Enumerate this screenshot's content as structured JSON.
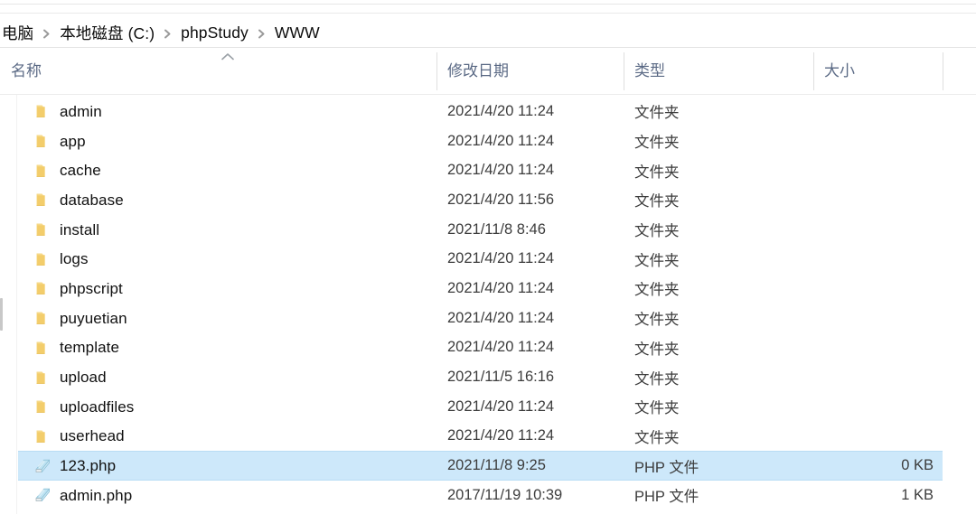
{
  "breadcrumb": {
    "separator_icon": "chevron-right-icon",
    "items": [
      {
        "label": "电脑"
      },
      {
        "label": "本地磁盘 (C:)"
      },
      {
        "label": "phpStudy"
      },
      {
        "label": "WWW"
      }
    ]
  },
  "columns": {
    "name": "名称",
    "date_modified": "修改日期",
    "type": "类型",
    "size": "大小",
    "sort_indicator": "sort-ascending-caret-icon"
  },
  "colors": {
    "selection_fill": "#cde8fa",
    "selection_border": "#b8dcf4",
    "header_text": "#5b6a85",
    "folder_icon": "#f2c14e",
    "php_icon": "#a8d8ea"
  },
  "rows": [
    {
      "name": "admin",
      "date": "2021/4/20 11:24",
      "type": "文件夹",
      "size": "",
      "icon": "folder-icon",
      "selected": false
    },
    {
      "name": "app",
      "date": "2021/4/20 11:24",
      "type": "文件夹",
      "size": "",
      "icon": "folder-icon",
      "selected": false
    },
    {
      "name": "cache",
      "date": "2021/4/20 11:24",
      "type": "文件夹",
      "size": "",
      "icon": "folder-icon",
      "selected": false
    },
    {
      "name": "database",
      "date": "2021/4/20 11:56",
      "type": "文件夹",
      "size": "",
      "icon": "folder-icon",
      "selected": false
    },
    {
      "name": "install",
      "date": "2021/11/8 8:46",
      "type": "文件夹",
      "size": "",
      "icon": "folder-icon",
      "selected": false
    },
    {
      "name": "logs",
      "date": "2021/4/20 11:24",
      "type": "文件夹",
      "size": "",
      "icon": "folder-icon",
      "selected": false
    },
    {
      "name": "phpscript",
      "date": "2021/4/20 11:24",
      "type": "文件夹",
      "size": "",
      "icon": "folder-icon",
      "selected": false
    },
    {
      "name": "puyuetian",
      "date": "2021/4/20 11:24",
      "type": "文件夹",
      "size": "",
      "icon": "folder-icon",
      "selected": false
    },
    {
      "name": "template",
      "date": "2021/4/20 11:24",
      "type": "文件夹",
      "size": "",
      "icon": "folder-icon",
      "selected": false
    },
    {
      "name": "upload",
      "date": "2021/11/5 16:16",
      "type": "文件夹",
      "size": "",
      "icon": "folder-icon",
      "selected": false
    },
    {
      "name": "uploadfiles",
      "date": "2021/4/20 11:24",
      "type": "文件夹",
      "size": "",
      "icon": "folder-icon",
      "selected": false
    },
    {
      "name": "userhead",
      "date": "2021/4/20 11:24",
      "type": "文件夹",
      "size": "",
      "icon": "folder-icon",
      "selected": false
    },
    {
      "name": "123.php",
      "date": "2021/11/8 9:25",
      "type": "PHP 文件",
      "size": "0 KB",
      "icon": "php-file-icon",
      "selected": true
    },
    {
      "name": "admin.php",
      "date": "2017/11/19 10:39",
      "type": "PHP 文件",
      "size": "1 KB",
      "icon": "php-file-icon",
      "selected": false
    }
  ]
}
